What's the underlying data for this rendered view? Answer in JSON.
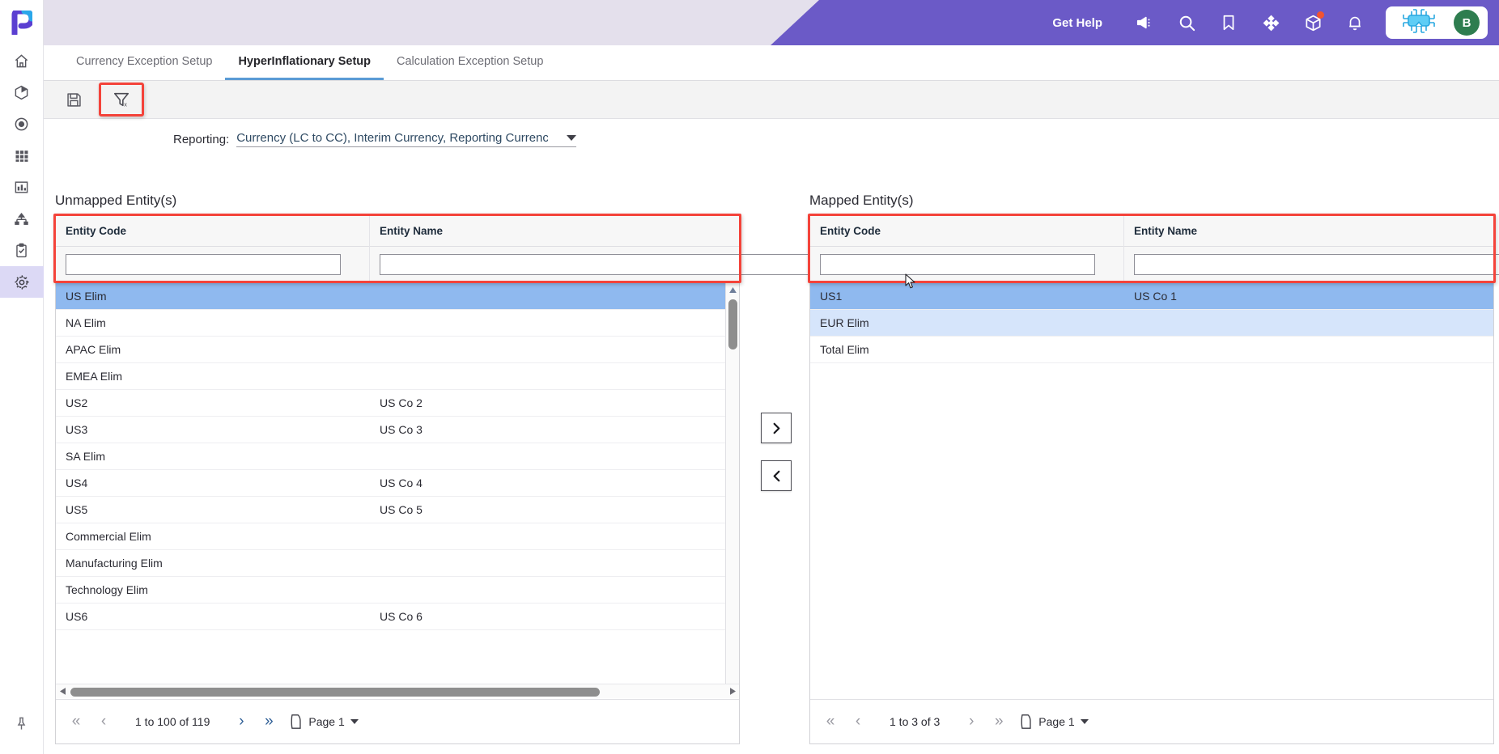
{
  "app": {
    "accent_purple": "#6b5ac7",
    "header_bg": "#e4e0ec",
    "highlight_red": "#f4433a",
    "tab_underline": "#5b9bd5",
    "row_selected": "#8fb9ef",
    "row_alt": "#d6e5fb",
    "avatar_bg": "#2e7d4f"
  },
  "topbar": {
    "get_help": "Get Help",
    "icons": [
      "megaphone-icon",
      "search-icon",
      "bookmark-icon",
      "target-icon",
      "package-icon",
      "bell-icon"
    ],
    "user": {
      "initial": "B"
    }
  },
  "rail": {
    "logo": "papm-logo",
    "items": [
      {
        "name": "home-icon",
        "active": false
      },
      {
        "name": "cube-icon",
        "active": false
      },
      {
        "name": "target-icon",
        "active": false
      },
      {
        "name": "grid-icon",
        "active": false
      },
      {
        "name": "chart-icon",
        "active": false
      },
      {
        "name": "hierarchy-icon",
        "active": false
      },
      {
        "name": "clipboard-icon",
        "active": false
      },
      {
        "name": "gear-icon",
        "active": true
      }
    ],
    "pin": "pin-icon"
  },
  "tabs": [
    {
      "label": "Currency Exception Setup",
      "active": false
    },
    {
      "label": "HyperInflationary Setup",
      "active": true
    },
    {
      "label": "Calculation Exception Setup",
      "active": false
    }
  ],
  "toolbar": {
    "save_label": "save-icon",
    "clear_filter_label": "clear-filter-icon"
  },
  "reporting": {
    "label": "Reporting:",
    "value": "Currency (LC to CC), Interim Currency, Reporting Currency",
    "display": "Currency (LC to CC), Interim Currency, Reporting Currenc"
  },
  "unmapped": {
    "title": "Unmapped Entity(s)",
    "columns": [
      "Entity Code",
      "Entity Name"
    ],
    "filters": {
      "code": "",
      "name": "",
      "placeholder": ""
    },
    "rows": [
      {
        "code": "US Elim",
        "name": "",
        "state": "selected"
      },
      {
        "code": "NA Elim",
        "name": "",
        "state": ""
      },
      {
        "code": "APAC Elim",
        "name": "",
        "state": ""
      },
      {
        "code": "EMEA Elim",
        "name": "",
        "state": ""
      },
      {
        "code": "US2",
        "name": "US Co 2",
        "state": ""
      },
      {
        "code": "US3",
        "name": "US Co 3",
        "state": ""
      },
      {
        "code": "SA Elim",
        "name": "",
        "state": ""
      },
      {
        "code": "US4",
        "name": "US Co 4",
        "state": ""
      },
      {
        "code": "US5",
        "name": "US Co 5",
        "state": ""
      },
      {
        "code": "Commercial Elim",
        "name": "",
        "state": ""
      },
      {
        "code": "Manufacturing Elim",
        "name": "",
        "state": ""
      },
      {
        "code": "Technology Elim",
        "name": "",
        "state": ""
      },
      {
        "code": "US6",
        "name": "US Co 6",
        "state": ""
      }
    ],
    "pager": {
      "count": "1 to 100 of 119",
      "page_label": "Page 1"
    }
  },
  "mapped": {
    "title": "Mapped Entity(s)",
    "columns": [
      "Entity Code",
      "Entity Name"
    ],
    "filters": {
      "code": "",
      "name": "",
      "placeholder": ""
    },
    "rows": [
      {
        "code": "US1",
        "name": "US Co 1",
        "state": "selected"
      },
      {
        "code": "EUR Elim",
        "name": "",
        "state": "alt"
      },
      {
        "code": "Total Elim",
        "name": "",
        "state": ""
      }
    ],
    "pager": {
      "count": "1 to 3 of 3",
      "page_label": "Page 1"
    }
  },
  "transfer": {
    "to_mapped": "chevron-right-icon",
    "to_unmapped": "chevron-left-icon"
  }
}
